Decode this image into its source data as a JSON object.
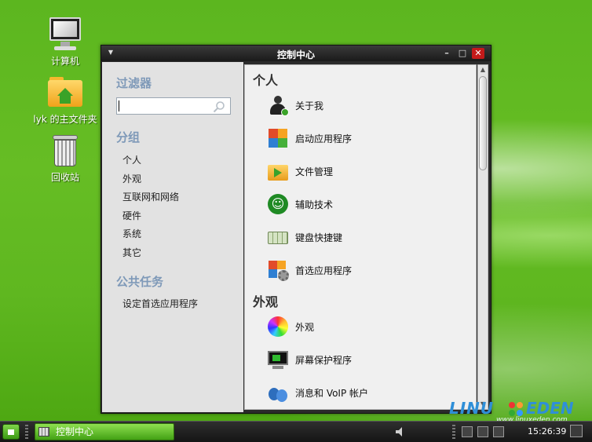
{
  "desktop": {
    "icons": [
      {
        "label": "计算机",
        "icon": "computer-icon"
      },
      {
        "label": "lyk 的主文件夹",
        "icon": "home-folder-icon"
      },
      {
        "label": "回收站",
        "icon": "trash-icon"
      }
    ]
  },
  "window": {
    "title": "控制中心",
    "buttons": {
      "minimize": "–",
      "maximize": "□",
      "close": "✕"
    },
    "sidebar": {
      "filter_heading": "过滤器",
      "search_value": "",
      "groups_heading": "分组",
      "groups": [
        "个人",
        "外观",
        "互联网和网络",
        "硬件",
        "系统",
        "其它"
      ],
      "tasks_heading": "公共任务",
      "tasks": [
        "设定首选应用程序"
      ]
    },
    "content": {
      "categories": [
        {
          "title": "个人",
          "items": [
            {
              "label": "关于我",
              "icon": "about-me-icon"
            },
            {
              "label": "启动应用程序",
              "icon": "startup-apps-icon"
            },
            {
              "label": "文件管理",
              "icon": "file-management-icon"
            },
            {
              "label": "辅助技术",
              "icon": "accessibility-icon"
            },
            {
              "label": "键盘快捷键",
              "icon": "keyboard-shortcuts-icon"
            },
            {
              "label": "首选应用程序",
              "icon": "preferred-apps-icon"
            }
          ]
        },
        {
          "title": "外观",
          "items": [
            {
              "label": "外观",
              "icon": "appearance-icon"
            },
            {
              "label": "屏幕保护程序",
              "icon": "screensaver-icon"
            },
            {
              "label": "消息和 VoIP 帐户",
              "icon": "messaging-voip-icon"
            }
          ]
        }
      ]
    }
  },
  "taskbar": {
    "task_label": "控制中心",
    "clock": "15:26:39"
  },
  "watermark": {
    "left": "LINU",
    "right": "EDEN",
    "url": "www.linuxeden.com"
  },
  "colors": {
    "desktop_green": "#58b41c",
    "sidebar_heading": "#7e99b8",
    "close_red": "#c41a1a"
  }
}
